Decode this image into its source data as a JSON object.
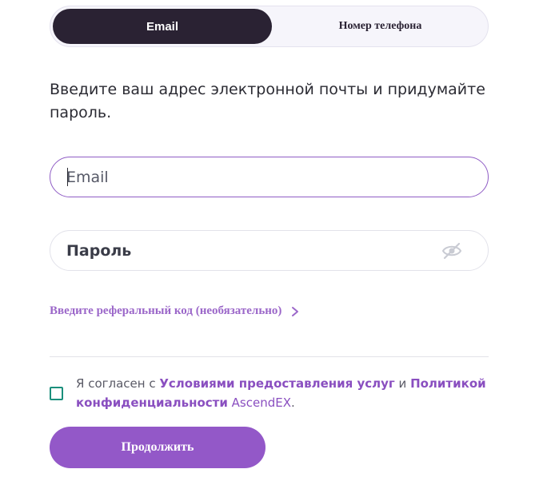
{
  "tabs": {
    "email_label": "Email",
    "phone_label": "Номер телефона"
  },
  "instruction": "Введите ваш адрес электронной почты и придумайте пароль.",
  "email_field": {
    "placeholder": "Email",
    "value": ""
  },
  "password_field": {
    "placeholder": "Пароль",
    "value": "",
    "toggle_icon": "eye-slash-icon"
  },
  "referral": {
    "label": "Введите реферальный код (необязательно)",
    "icon": "chevron-right-icon"
  },
  "agreement": {
    "checked": false,
    "prefix": "Я согласен с ",
    "terms_link": "Условиями предоставления услуг",
    "conjunction": " и ",
    "privacy_link": "Политикой конфиденциальности",
    "brand": " AscendEX",
    "suffix": "."
  },
  "continue_button": "Продолжить",
  "colors": {
    "accent": "#9358c8",
    "dark_tab": "#2a2233",
    "checkbox_border": "#1b8f7c",
    "link": "#8a4fc0"
  }
}
